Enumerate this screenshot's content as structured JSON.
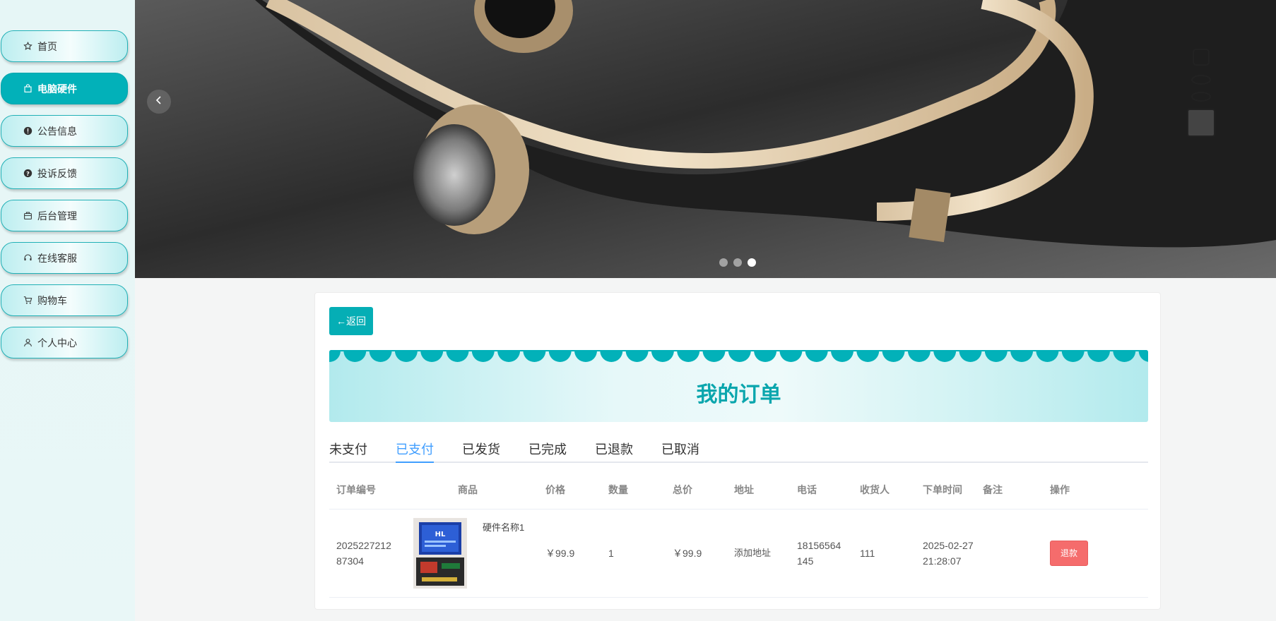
{
  "sidebar": {
    "items": [
      {
        "label": "首页",
        "icon": "star-icon"
      },
      {
        "label": "电脑硬件",
        "icon": "bag-icon"
      },
      {
        "label": "公告信息",
        "icon": "alert-icon"
      },
      {
        "label": "投诉反馈",
        "icon": "question-icon"
      },
      {
        "label": "后台管理",
        "icon": "briefcase-icon"
      },
      {
        "label": "在线客服",
        "icon": "headset-icon"
      },
      {
        "label": "购物车",
        "icon": "cart-icon"
      },
      {
        "label": "个人中心",
        "icon": "user-icon"
      }
    ],
    "active_index": 1
  },
  "carousel": {
    "prev_icon": "chevron-left-icon",
    "slide_count": 3,
    "active_slide": 3
  },
  "back_button": "←返回",
  "page_title": "我的订单",
  "tabs": [
    "未支付",
    "已支付",
    "已发货",
    "已完成",
    "已退款",
    "已取消"
  ],
  "active_tab": "已支付",
  "table": {
    "headers": [
      "订单编号",
      "商品",
      "价格",
      "数量",
      "总价",
      "地址",
      "电话",
      "收货人",
      "下单时间",
      "备注",
      "操作"
    ],
    "rows": [
      {
        "order_no": "202522721287304",
        "product_name": "硬件名称1",
        "price": "￥99.9",
        "quantity": "1",
        "total": "￥99.9",
        "address": "添加地址",
        "phone": "18156564145",
        "receiver": "111",
        "order_time": "2025-02-27 21:28:07",
        "remark": "",
        "action": "退款"
      }
    ]
  },
  "colors": {
    "accent": "#02b1b9",
    "tab_active": "#409eff",
    "refund": "#f56c6c"
  }
}
